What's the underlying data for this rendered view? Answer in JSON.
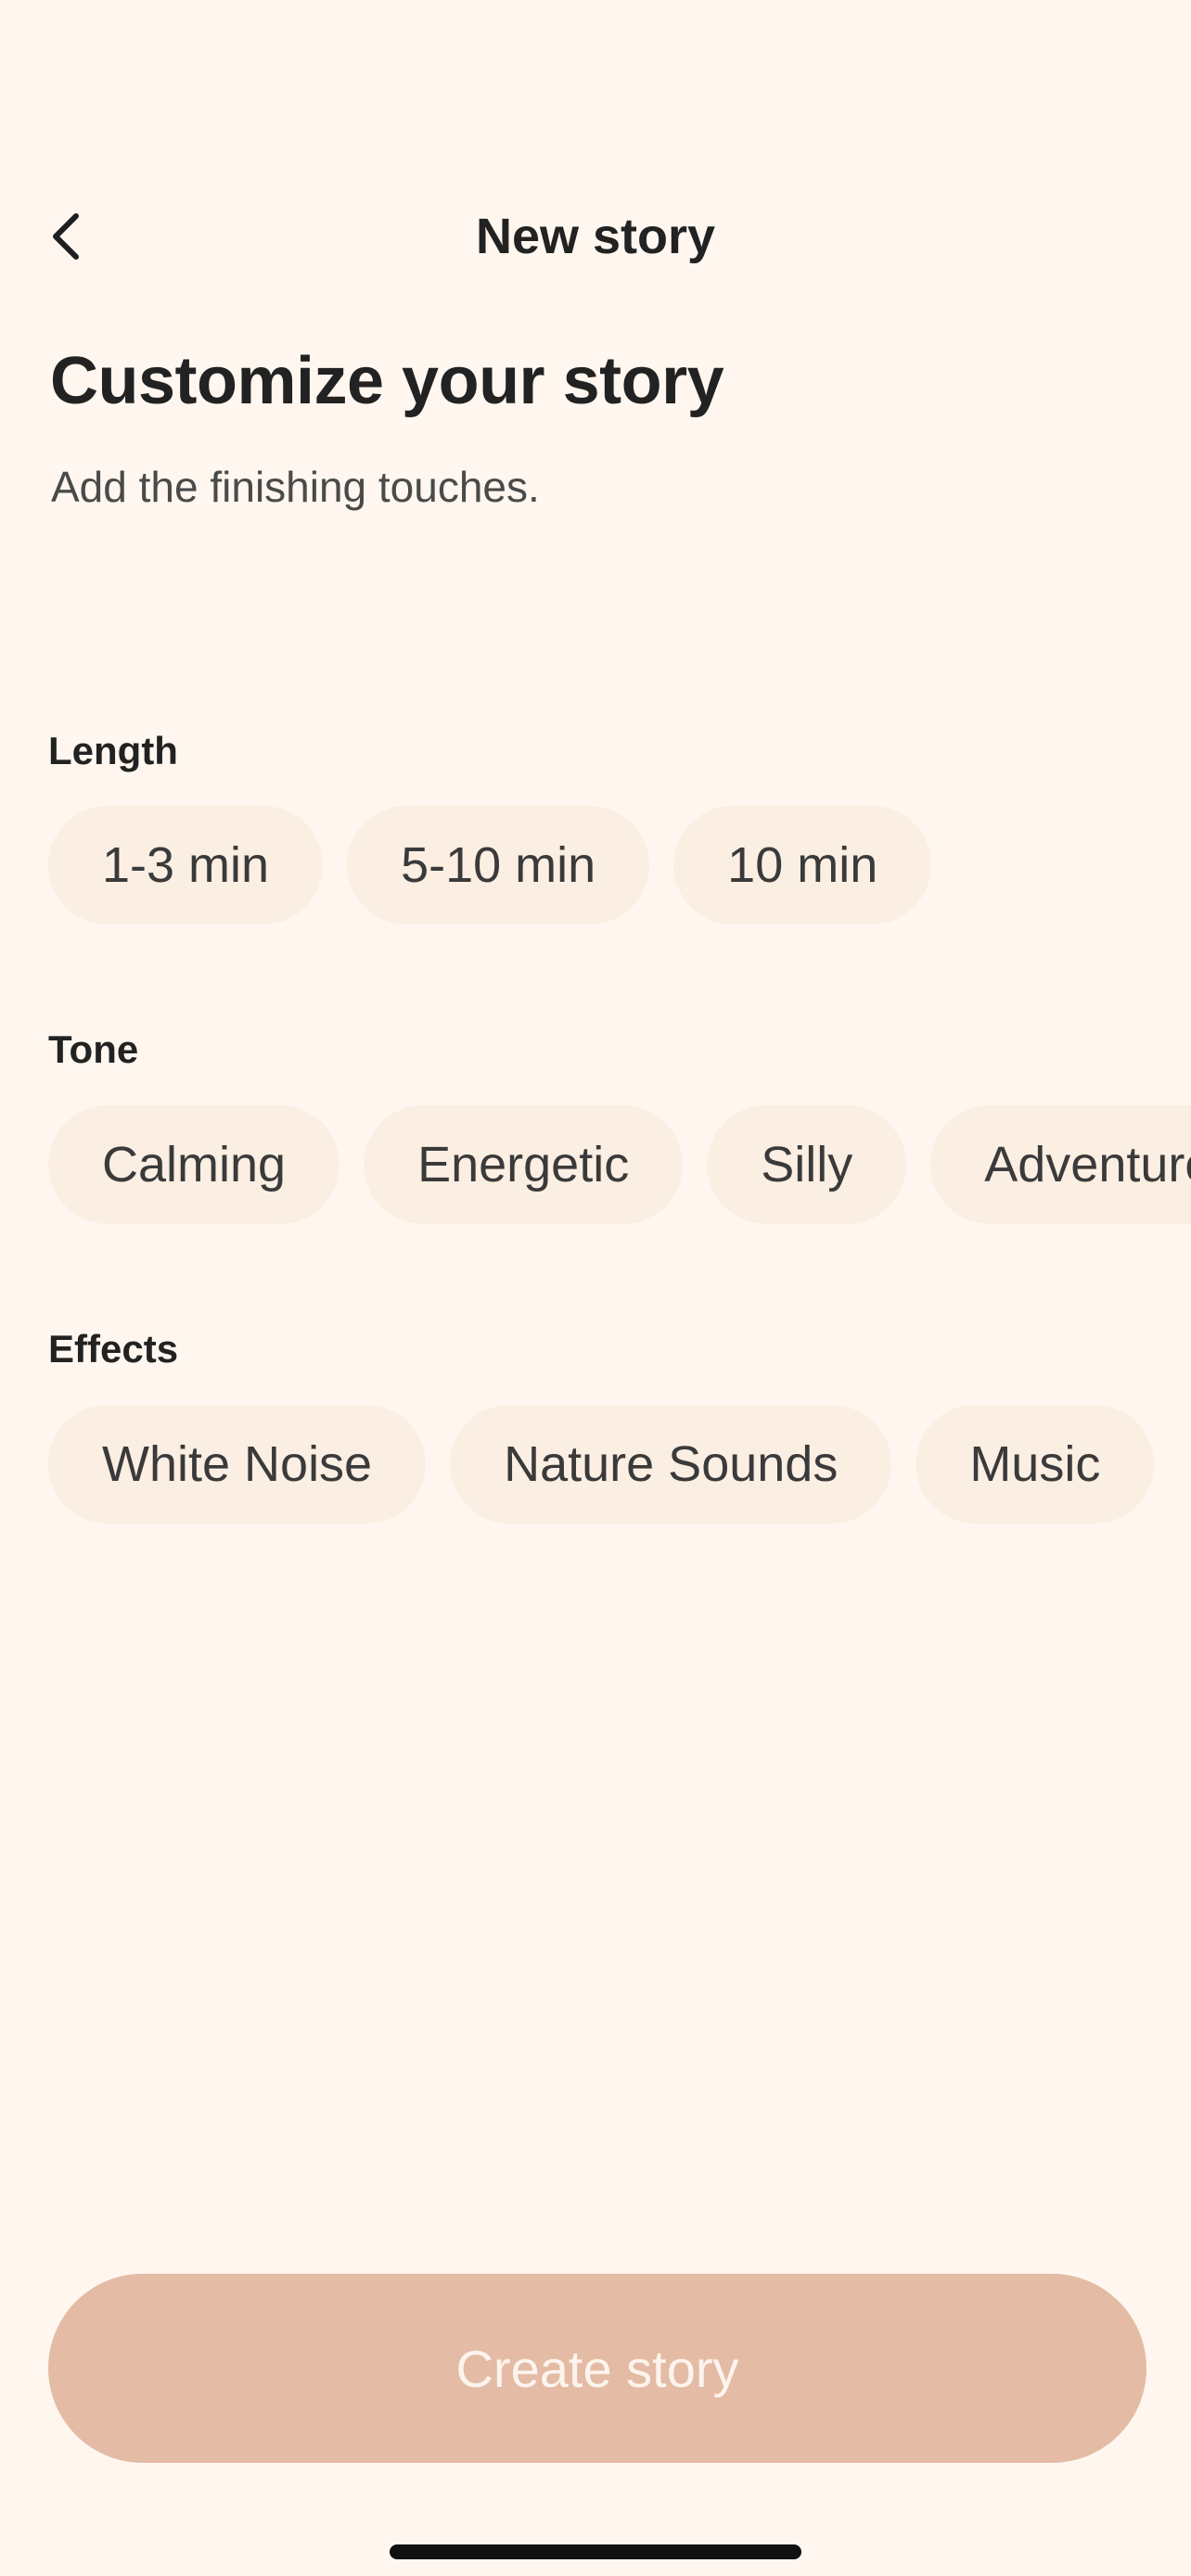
{
  "nav": {
    "title": "New story",
    "back_icon": "chevron-left-icon"
  },
  "header": {
    "title": "Customize your story",
    "subtitle": "Add the finishing touches."
  },
  "sections": {
    "length": {
      "label": "Length",
      "options": [
        "1-3 min",
        "5-10 min",
        "10 min"
      ]
    },
    "tone": {
      "label": "Tone",
      "options": [
        "Calming",
        "Energetic",
        "Silly",
        "Adventurous"
      ]
    },
    "effects": {
      "label": "Effects",
      "options": [
        "White Noise",
        "Nature Sounds",
        "Music"
      ]
    }
  },
  "cta": {
    "label": "Create story"
  },
  "colors": {
    "background": "#fff7ef",
    "chip": "#fbeee3",
    "cta": "#e4bba5",
    "cta_text": "#fdf4ee"
  }
}
